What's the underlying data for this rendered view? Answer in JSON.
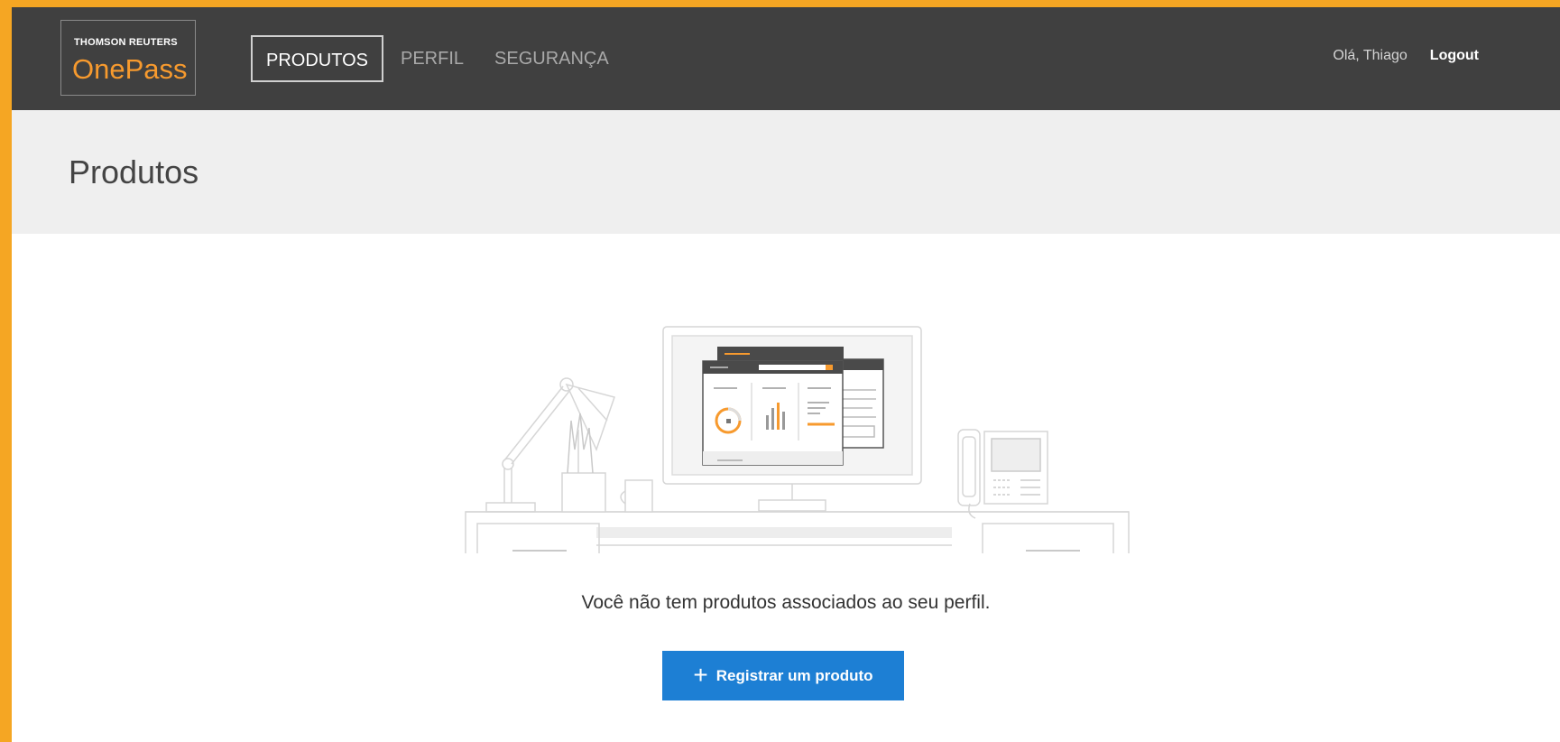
{
  "brand": {
    "company": "THOMSON REUTERS",
    "product": "OnePass"
  },
  "nav": {
    "items": [
      {
        "label": "PRODUTOS",
        "active": true
      },
      {
        "label": "PERFIL",
        "active": false
      },
      {
        "label": "SEGURANÇA",
        "active": false
      }
    ]
  },
  "user": {
    "greeting": "Olá, Thiago",
    "logout_label": "Logout"
  },
  "page": {
    "title": "Produtos"
  },
  "empty_state": {
    "message": "Você não tem produtos associados ao seu perfil.",
    "button_label": "Registrar um produto",
    "button_icon": "plus-icon"
  },
  "colors": {
    "topbar": "#404040",
    "accent_orange": "#f79a2e",
    "button_blue": "#1d7fd4",
    "page_header_bg": "#efefef",
    "frame_border": "#f5a623"
  }
}
